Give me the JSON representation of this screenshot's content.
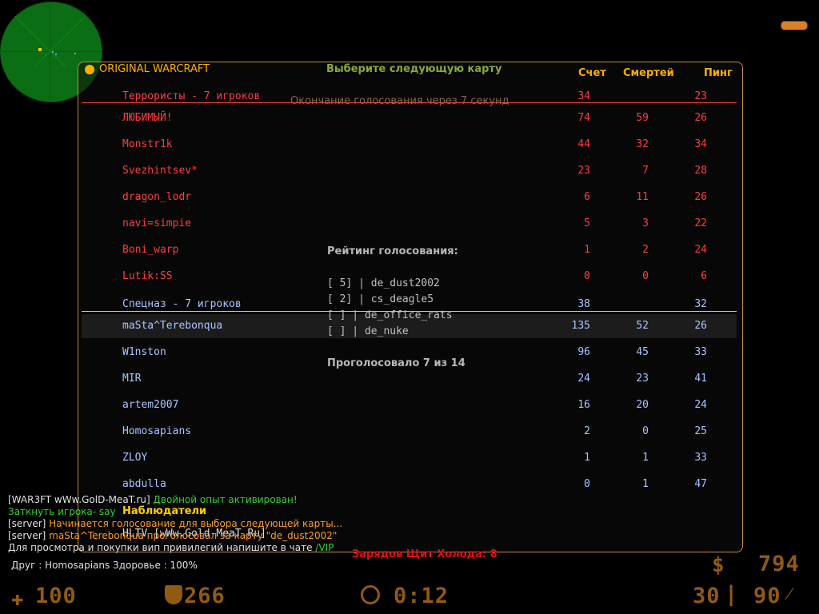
{
  "server": {
    "name": "ORIGINAL WARCRAFT"
  },
  "vote": {
    "title": "Выберите следующую карту",
    "ends": "Окончание голосования через 7 секунд",
    "rating_title": "Рейтинг голосования:",
    "options": [
      "[ 5] | de_dust2002",
      "[ 2] | cs_deagle5",
      "[   ] | de_office_rats",
      "[   ] | de_nuke"
    ],
    "count": "Проголосовало 7 из 14"
  },
  "headers": {
    "score": "Счет",
    "deaths": "Смертей",
    "ping": "Пинг"
  },
  "terrorists": {
    "label": "Террористы   -  7 игроков",
    "score": "34",
    "ping": "23",
    "players": [
      {
        "name": "ЛЮБИМЫЙ!",
        "score": "74",
        "deaths": "59",
        "ping": "26"
      },
      {
        "name": "Monstr1k",
        "score": "44",
        "deaths": "32",
        "ping": "34"
      },
      {
        "name": "Svezhintsev*",
        "score": "23",
        "deaths": "7",
        "ping": "28"
      },
      {
        "name": "dragon_lodr",
        "score": "6",
        "deaths": "11",
        "ping": "26"
      },
      {
        "name": "navi=simpie",
        "score": "5",
        "deaths": "3",
        "ping": "22"
      },
      {
        "name": "Boni_warp",
        "score": "1",
        "deaths": "2",
        "ping": "24"
      },
      {
        "name": "Lutik:SS",
        "score": "0",
        "deaths": "0",
        "ping": "6"
      }
    ]
  },
  "cts": {
    "label": "Спецназ   -  7 игроков",
    "score": "38",
    "ping": "32",
    "players": [
      {
        "name": "maSta^Terebonqua",
        "score": "135",
        "deaths": "52",
        "ping": "26"
      },
      {
        "name": "W1nston",
        "score": "96",
        "deaths": "45",
        "ping": "33"
      },
      {
        "name": "MIR",
        "score": "24",
        "deaths": "23",
        "ping": "41"
      },
      {
        "name": "artem2007",
        "score": "16",
        "deaths": "20",
        "ping": "24"
      },
      {
        "name": "Homosapians",
        "score": "2",
        "deaths": "0",
        "ping": "25"
      },
      {
        "name": "ZLOY",
        "score": "1",
        "deaths": "1",
        "ping": "33"
      },
      {
        "name": "abdulla",
        "score": "0",
        "deaths": "1",
        "ping": "47"
      }
    ]
  },
  "spectators": {
    "label": "Наблюдатели",
    "hltv": "HLTV [wWw.Gold-MeaT.Ru]"
  },
  "chat": {
    "line1_a": "[WAR3FT wWw.GolD-MeaT.ru] ",
    "line1_b": "Двойной опыт активирован!",
    "line2": "Заткнуть игрока- say ",
    "line3_a": "[server] ",
    "line3_b": "Начинается голосование для выбора следующей карты...",
    "line4_a": "[server] ",
    "line4_b": "maSta^Terebonqua проголосовал за карту \"de_dust2002\"",
    "line5_a": "Для просмотра и покупки вип привилегий напишите в чате ",
    "line5_b": "/VIP"
  },
  "frost": "Зарядов Щит Холода: 8",
  "status": "Друг : Homosapians  Здоровье : 100%",
  "hud": {
    "health": "100",
    "armor": "266",
    "timer": "0:12",
    "money": "794",
    "clip": "30",
    "reserve": "90",
    "accent": "#c07818"
  }
}
